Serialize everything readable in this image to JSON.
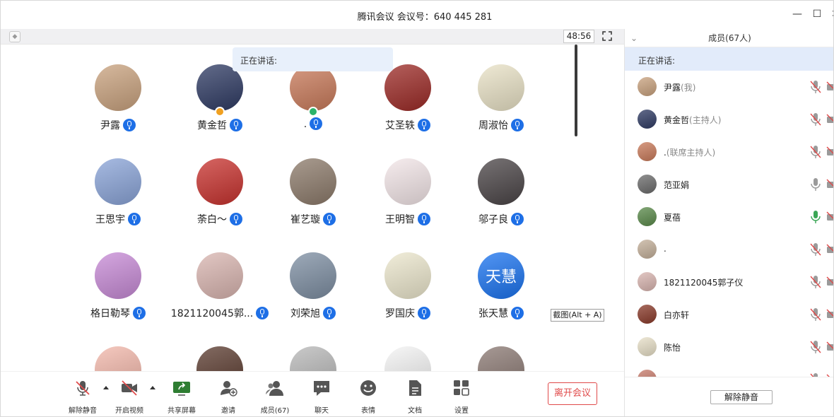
{
  "window": {
    "title": "腾讯会议 会议号：640 445 281",
    "minimize": "—",
    "maximize": "☐",
    "close": "✕"
  },
  "video_bar": {
    "timer": "48:56"
  },
  "speaking_label": "正在讲话:",
  "grid": [
    {
      "name": "尹露",
      "avatar_color": "#c9a27e",
      "role": ""
    },
    {
      "name": "黄金哲",
      "avatar_color": "#2e3a63",
      "role": "host"
    },
    {
      "name": ".",
      "avatar_color": "#c97a5a",
      "role": "cohost"
    },
    {
      "name": "艾圣轶",
      "avatar_color": "#9c2a26",
      "role": ""
    },
    {
      "name": "周淑怡",
      "avatar_color": "#e9e2c6",
      "role": ""
    },
    {
      "name": "王思宇",
      "avatar_color": "#8aa4d8",
      "role": ""
    },
    {
      "name": "荼白～",
      "avatar_color": "#c8322e",
      "role": ""
    },
    {
      "name": "崔艺璇",
      "avatar_color": "#8c7a6a",
      "role": ""
    },
    {
      "name": "王明智",
      "avatar_color": "#f3e6e8",
      "role": ""
    },
    {
      "name": "邬子良",
      "avatar_color": "#4a4446",
      "role": ""
    },
    {
      "name": "格日勒琴",
      "avatar_color": "#c78ad6",
      "role": ""
    },
    {
      "name": "1821120045郭...",
      "avatar_color": "#d9b5b0",
      "role": ""
    },
    {
      "name": "刘荣旭",
      "avatar_color": "#7d8ea2",
      "role": ""
    },
    {
      "name": "罗国庆",
      "avatar_color": "#ece7cd",
      "role": ""
    },
    {
      "name": "张天慧",
      "avatar_color": "#1a73f0",
      "role": "",
      "avatar_text": "天慧"
    },
    {
      "name": "",
      "avatar_color": "#f2b7aa",
      "role": ""
    },
    {
      "name": "",
      "avatar_color": "#5a3a2e",
      "role": ""
    },
    {
      "name": "",
      "avatar_color": "#b8b8b8",
      "role": ""
    },
    {
      "name": "",
      "avatar_color": "#f4f4f4",
      "role": ""
    },
    {
      "name": "",
      "avatar_color": "#8a7872",
      "role": ""
    }
  ],
  "screenshot_hint": "截图(Alt + A)",
  "toolbar": {
    "unmute": "解除静音",
    "video": "开启视频",
    "share": "共享屏幕",
    "invite": "邀请",
    "members": "成员(67)",
    "chat": "聊天",
    "emoji": "表情",
    "docs": "文档",
    "settings": "设置",
    "leave": "离开会议"
  },
  "panel": {
    "title": "成员(67人)",
    "speaking": "正在讲话:",
    "unmute_all": "解除静音",
    "members": [
      {
        "name": "尹露",
        "role": "(我)",
        "avatar_color": "#c9a27e",
        "mic": "muted"
      },
      {
        "name": "黄金哲",
        "role": "(主持人)",
        "avatar_color": "#2e3a63",
        "mic": "muted"
      },
      {
        "name": ".",
        "role": "(联席主持人)",
        "avatar_color": "#c97a5a",
        "mic": "muted"
      },
      {
        "name": "范亚娟",
        "role": "",
        "avatar_color": "#6b6b6b",
        "mic": "on"
      },
      {
        "name": "夏蓓",
        "role": "",
        "avatar_color": "#5a8a4a",
        "mic": "active"
      },
      {
        "name": ".",
        "role": "",
        "avatar_color": "#c4b09a",
        "mic": "muted"
      },
      {
        "name": "1821120045郭子仪",
        "role": "",
        "avatar_color": "#d9b5b0",
        "mic": "muted"
      },
      {
        "name": "白亦轩",
        "role": "",
        "avatar_color": "#8a3a2a",
        "mic": "muted"
      },
      {
        "name": "陈怡",
        "role": "",
        "avatar_color": "#e8e0c8",
        "mic": "muted"
      },
      {
        "name": "",
        "role": "",
        "avatar_color": "#c77a6a",
        "mic": "muted"
      }
    ]
  },
  "colors": {
    "accent": "#1e6fe6",
    "danger": "#e04a4a",
    "panel_speaking_bg": "#e2ebfa",
    "mic_active": "#3aa655"
  }
}
